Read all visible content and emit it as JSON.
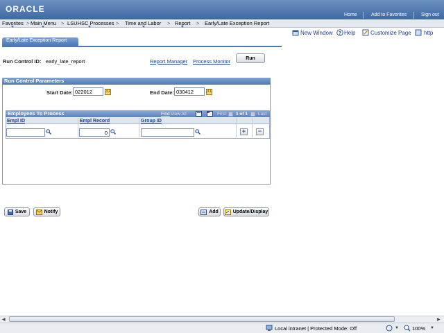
{
  "header": {
    "logo_text": "ORACLE",
    "links": [
      "Home",
      "Add to Favorites",
      "Sign out"
    ]
  },
  "nav": {
    "items": [
      "Favorites",
      "Main Menu",
      "LSUHSC Processes",
      "Time and Labor",
      "Report",
      "Early/Late Exception Report"
    ],
    "separator": ">"
  },
  "toolbar": {
    "new_window": "New Window",
    "help": "Help",
    "customize_page": "Customize Page",
    "http": "http"
  },
  "page": {
    "tab_label": "Early/Late Exception Report",
    "run_control_label": "Run Control ID:",
    "run_control_value": "early_late_report",
    "report_manager": "Report Manager",
    "process_monitor": "Process Monitor",
    "run_button": "Run"
  },
  "params": {
    "title": "Run Control Parameters",
    "start_date_label": "Start Date:",
    "start_date_value": "022012",
    "end_date_label": "End Date:",
    "end_date_value": "030412"
  },
  "grid": {
    "title": "Employees To Process",
    "find": "Find",
    "view_all": "View All",
    "first": "First",
    "count": "1 of 1",
    "last": "Last",
    "columns": [
      "Empl ID",
      "Empl Record",
      "Group ID"
    ],
    "row": {
      "empl_id": "",
      "empl_record": "0",
      "group_id": ""
    },
    "add_row": "+",
    "delete_row": "−"
  },
  "buttons": {
    "save": "Save",
    "notify": "Notify",
    "add": "Add",
    "update_display": "Update/Display"
  },
  "status": {
    "zone": "Local intranet | Protected Mode: Off",
    "zoom": "100%"
  },
  "colors": {
    "header_blue": "#3f69a5",
    "link_blue": "#1d3c8a",
    "group_header": "#4f79b4"
  }
}
